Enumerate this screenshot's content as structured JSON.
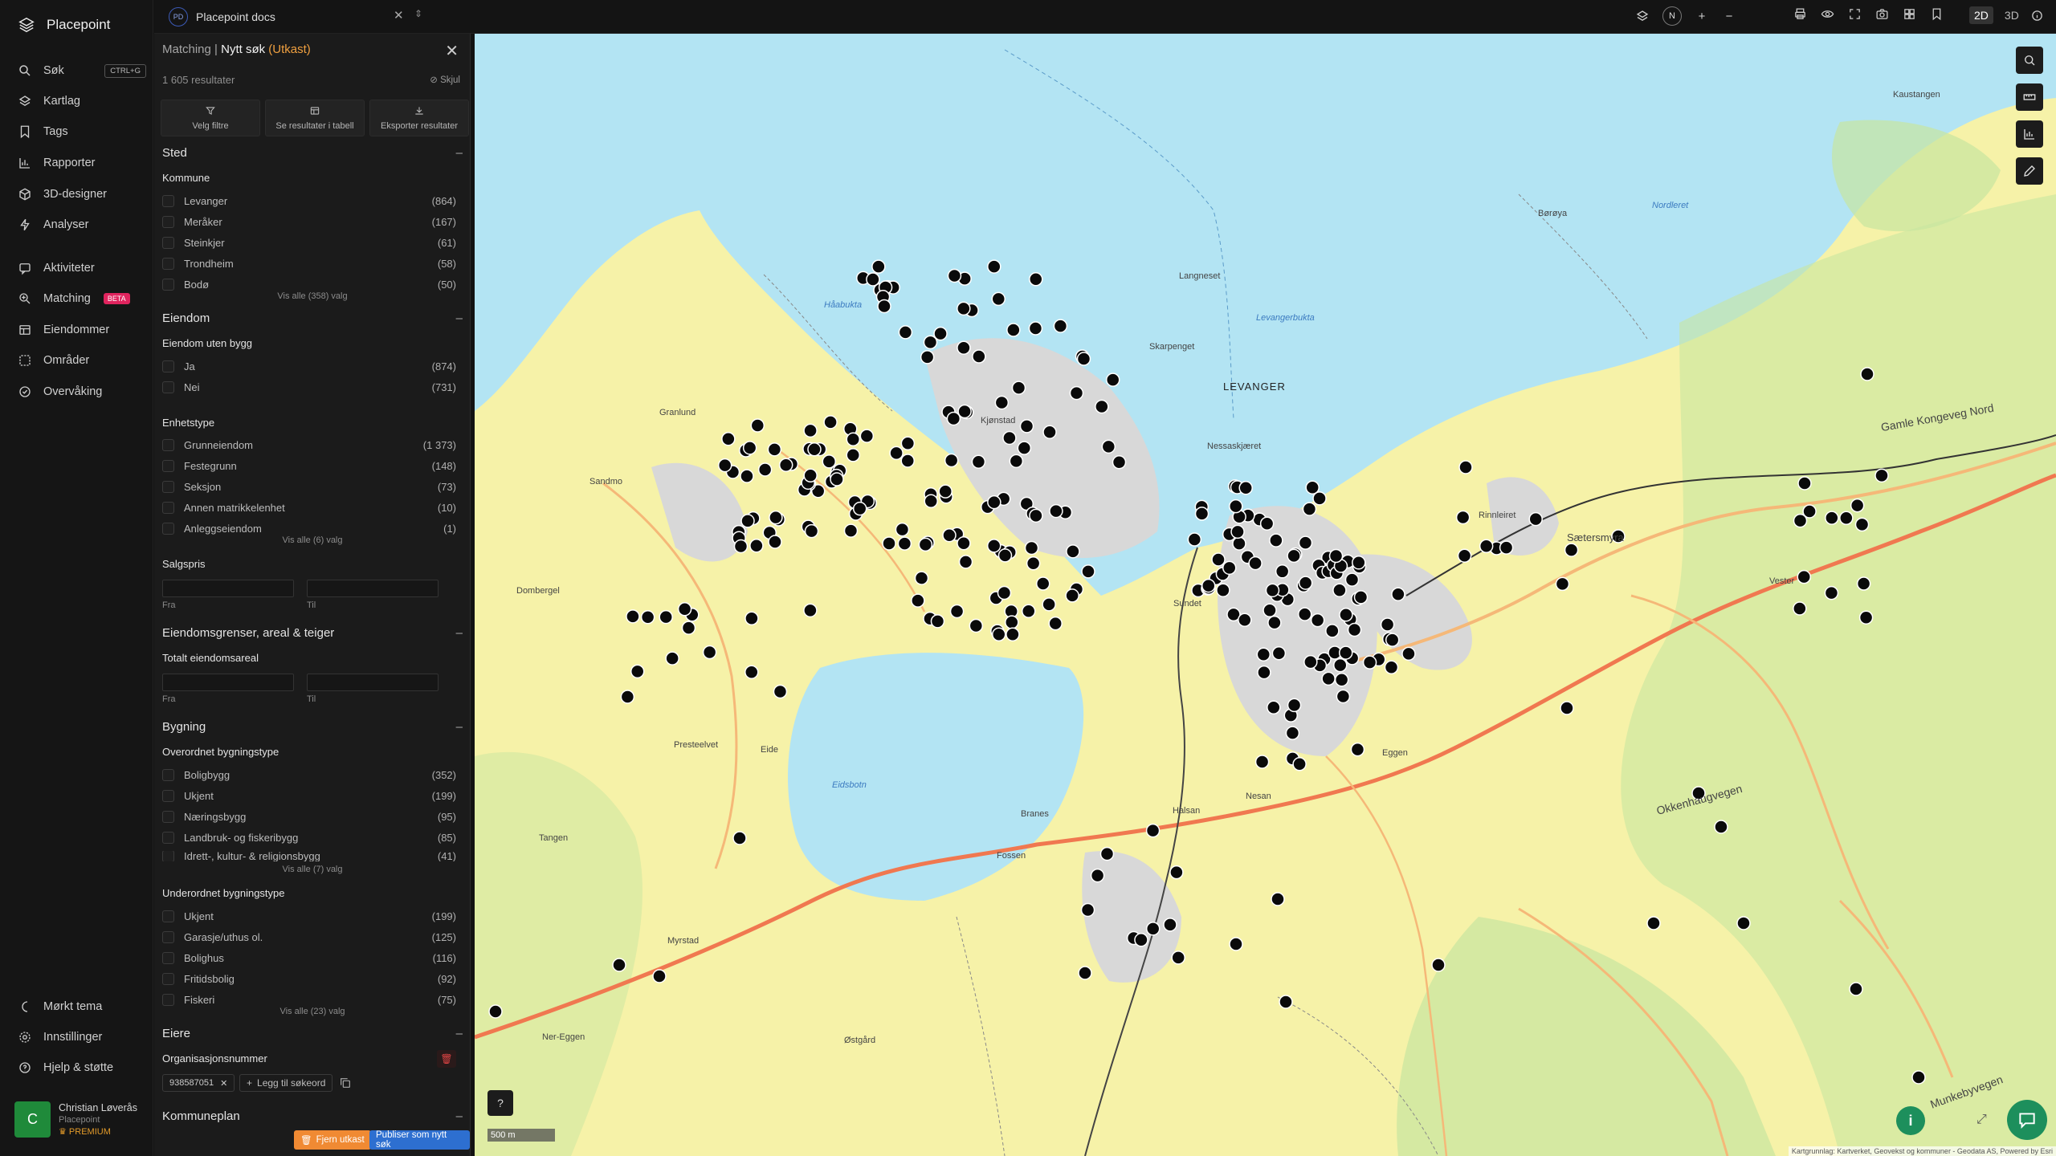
{
  "brand": {
    "name": "Placepoint"
  },
  "nav": {
    "items": [
      {
        "label": "Søk",
        "shortcut": "CTRL+G"
      },
      {
        "label": "Kartlag"
      },
      {
        "label": "Tags"
      },
      {
        "label": "Rapporter"
      },
      {
        "label": "3D-designer"
      },
      {
        "label": "Analyser"
      },
      {
        "label": "Aktiviteter"
      },
      {
        "label": "Matching",
        "badge": "BETA"
      },
      {
        "label": "Eiendommer"
      },
      {
        "label": "Områder"
      },
      {
        "label": "Overvåking"
      }
    ],
    "bottom": [
      {
        "label": "Mørkt tema"
      },
      {
        "label": "Innstillinger"
      },
      {
        "label": "Hjelp & støtte"
      }
    ],
    "user": {
      "initial": "C",
      "name": "Christian Løverås",
      "org": "Placepoint",
      "plan": "PREMIUM"
    }
  },
  "topbar": {
    "doc_badge": "PD",
    "doc_title": "Placepoint docs",
    "compass": "N",
    "mode_2d": "2D",
    "mode_3d": "3D"
  },
  "panel": {
    "crumb_parent": "Matching",
    "title": "Nytt søk",
    "draft": "(Utkast)",
    "results": "1 605 resultater",
    "hide": "Skjul",
    "actions": [
      "Velg filtre",
      "Se resultater i tabell",
      "Eksporter resultater"
    ],
    "sections": {
      "sted": "Sted",
      "kommune": "Kommune",
      "kommune_opts": [
        {
          "label": "Levanger",
          "count": "(864)"
        },
        {
          "label": "Meråker",
          "count": "(167)"
        },
        {
          "label": "Steinkjer",
          "count": "(61)"
        },
        {
          "label": "Trondheim",
          "count": "(58)"
        },
        {
          "label": "Bodø",
          "count": "(50)"
        }
      ],
      "kommune_all": "Vis alle (358) valg",
      "eiendom": "Eiendom",
      "uten_bygg": "Eiendom uten bygg",
      "uten_bygg_opts": [
        {
          "label": "Ja",
          "count": "(874)"
        },
        {
          "label": "Nei",
          "count": "(731)"
        }
      ],
      "enhetstype": "Enhetstype",
      "enhetstype_opts": [
        {
          "label": "Grunneiendom",
          "count": "(1 373)"
        },
        {
          "label": "Festegrunn",
          "count": "(148)"
        },
        {
          "label": "Seksjon",
          "count": "(73)"
        },
        {
          "label": "Annen matrikkelenhet",
          "count": "(10)"
        },
        {
          "label": "Anleggseiendom",
          "count": "(1)"
        }
      ],
      "enhetstype_all": "Vis alle (6) valg",
      "salgspris": "Salgspris",
      "fra": "Fra",
      "til": "Til",
      "grenser": "Eiendomsgrenser, areal & teiger",
      "totalt_areal": "Totalt eiendomsareal",
      "bygning": "Bygning",
      "overordnet": "Overordnet bygningstype",
      "overordnet_opts": [
        {
          "label": "Boligbygg",
          "count": "(352)"
        },
        {
          "label": "Ukjent",
          "count": "(199)"
        },
        {
          "label": "Næringsbygg",
          "count": "(95)"
        },
        {
          "label": "Landbruk- og fiskeribygg",
          "count": "(85)"
        },
        {
          "label": "Idrett-, kultur- & religionsbygg",
          "count": "(41)"
        }
      ],
      "overordnet_all": "Vis alle (7) valg",
      "underordnet": "Underordnet bygningstype",
      "underordnet_opts": [
        {
          "label": "Ukjent",
          "count": "(199)"
        },
        {
          "label": "Garasje/uthus ol.",
          "count": "(125)"
        },
        {
          "label": "Bolighus",
          "count": "(116)"
        },
        {
          "label": "Fritidsbolig",
          "count": "(92)"
        },
        {
          "label": "Fiskeri",
          "count": "(75)"
        }
      ],
      "underordnet_all": "Vis alle (23) valg",
      "eiere": "Eiere",
      "orgnr": "Organisasjonsnummer",
      "orgnr_value": "938587051",
      "add_keyword": "Legg til søkeord",
      "kommuneplan": "Kommuneplan"
    },
    "remove_draft": "Fjern utkast",
    "publish": "Publiser som nytt søk"
  },
  "map": {
    "labels": {
      "levanger": "LEVANGER",
      "eidsbotn": "Eidsbotn",
      "levangerbukta": "Levangerbukta",
      "haabukta": "Håabukta",
      "gamle_kongeveg": "Gamle Kongeveg Nord",
      "setersmyra": "Sætersmyra",
      "okkenhaugvegen": "Okkenhaugvegen",
      "munkebyvegen": "Munkebyvegen",
      "kaustangen": "Kaustangen",
      "nordleret": "Nordleret",
      "boreya": "Børøya",
      "skarpenget": "Skarpenget",
      "langneset": "Langneset",
      "nessaskjaeret": "Nessaskjæret",
      "rinnleiret": "Rinnleiret",
      "prestelvet": "Presteelvet",
      "sanden": "Sandmo",
      "granlund": "Granlund",
      "tangen": "Tangen",
      "fossen": "Fossen",
      "branes": "Branes",
      "halsan": "Halsan",
      "nesan": "Nesan",
      "eggen": "Eggen",
      "sundet": "Sundet",
      "ostfold": "Østgård",
      "dombergel": "Dombergel",
      "myrstad": "Myrstad",
      "kjonstad": "Kjønstad",
      "eide": "Eide",
      "ner_eggen": "Ner-Eggen",
      "vester": "Vester"
    },
    "scale": "500 m",
    "help": "?",
    "attribution": "Kartgrunnlag: Kartverket, Geovekst og kommuner - Geodata AS, Powered by Esri"
  }
}
